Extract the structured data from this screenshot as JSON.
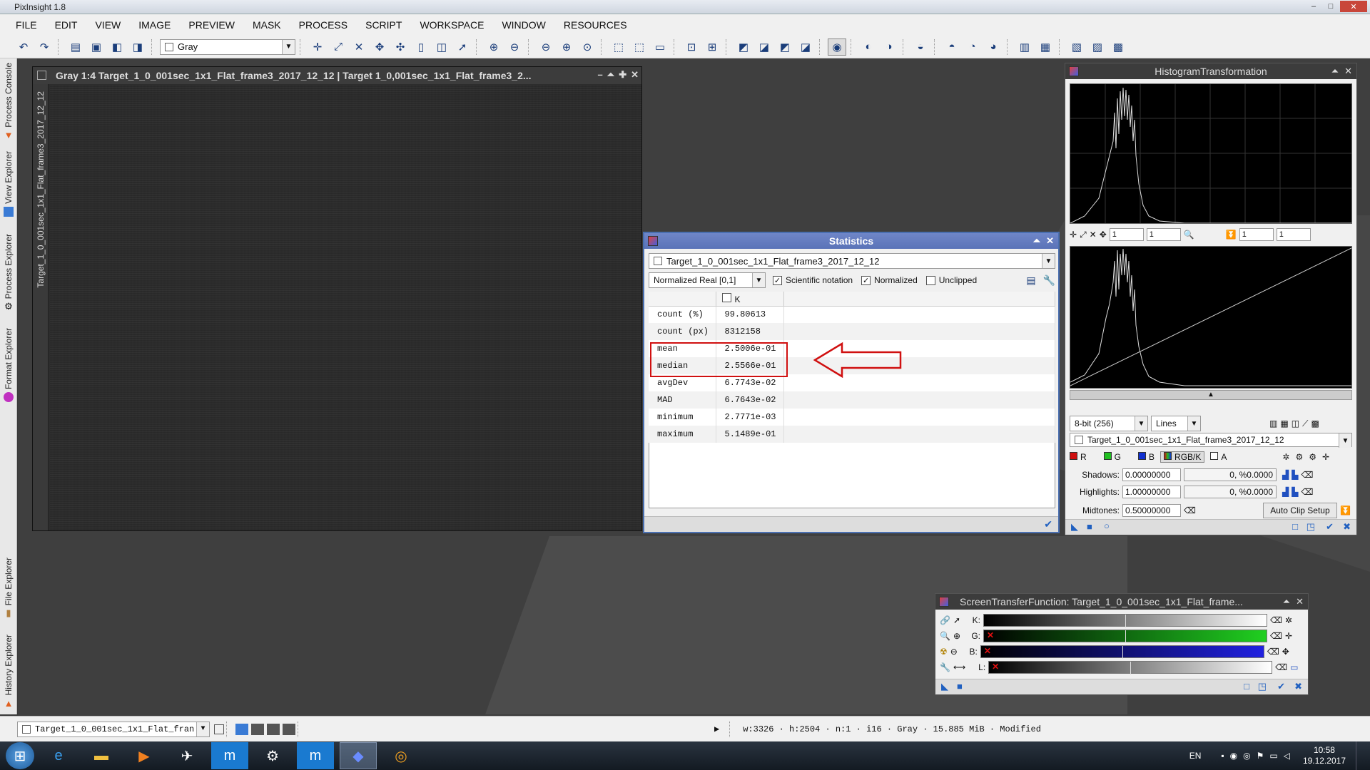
{
  "app": {
    "title": "PixInsight 1.8",
    "win_buttons": [
      "–",
      "□",
      "✕"
    ]
  },
  "menu": [
    "FILE",
    "EDIT",
    "VIEW",
    "IMAGE",
    "PREVIEW",
    "MASK",
    "PROCESS",
    "SCRIPT",
    "WORKSPACE",
    "WINDOW",
    "RESOURCES"
  ],
  "toolbar": {
    "channel_combo": "Gray"
  },
  "left_dock": {
    "tabs": [
      "Process Console",
      "View Explorer",
      "Process Explorer",
      "Format Explorer",
      "File Explorer",
      "History Explorer"
    ]
  },
  "image_window": {
    "title": "Gray 1:4 Target_1_0_001sec_1x1_Flat_frame3_2017_12_12 | Target 1_0,001sec_1x1_Flat_frame3_2...",
    "side_label": "Target_1_0_001sec_1x1_Flat_frame3_2017_12_12"
  },
  "statistics": {
    "title": "Statistics",
    "view": "Target_1_0_001sec_1x1_Flat_frame3_2017_12_12",
    "range": "Normalized Real [0,1]",
    "options": [
      {
        "label": "Scientific notation",
        "checked": true
      },
      {
        "label": "Normalized",
        "checked": true
      },
      {
        "label": "Unclipped",
        "checked": false
      }
    ],
    "channel_header": "K",
    "rows": [
      {
        "name": "count (%)",
        "value": "99.80613"
      },
      {
        "name": "count (px)",
        "value": "8312158"
      },
      {
        "name": "mean",
        "value": "2.5006e-01"
      },
      {
        "name": "median",
        "value": "2.5566e-01"
      },
      {
        "name": "avgDev",
        "value": "6.7743e-02"
      },
      {
        "name": "MAD",
        "value": "6.7643e-02"
      },
      {
        "name": "minimum",
        "value": "2.7771e-03"
      },
      {
        "name": "maximum",
        "value": "5.1489e-01"
      }
    ],
    "annotation_color": "#d01010"
  },
  "histogram": {
    "title": "HistogramTransformation",
    "zoom_values": [
      "1",
      "1",
      "1",
      "1"
    ],
    "bit_combo": "8-bit (256)",
    "graph_combo": "Lines",
    "view": "Target_1_0_001sec_1x1_Flat_frame3_2017_12_12",
    "channels": [
      {
        "label": "R",
        "color": "#d01010"
      },
      {
        "label": "G",
        "color": "#20c020"
      },
      {
        "label": "B",
        "color": "#1030d0"
      },
      {
        "label": "RGB/K",
        "color": "#444444"
      },
      {
        "label": "A",
        "color": "#ffffff"
      }
    ],
    "shadows": {
      "label": "Shadows:",
      "value": "0.00000000",
      "clip": "0, %0.0000"
    },
    "highlights": {
      "label": "Highlights:",
      "value": "1.00000000",
      "clip": "0, %0.0000"
    },
    "midtones": {
      "label": "Midtones:",
      "value": "0.50000000"
    },
    "auto_clip": "Auto Clip Setup"
  },
  "stf": {
    "title": "ScreenTransferFunction: Target_1_0_001sec_1x1_Flat_frame...",
    "channels": [
      {
        "label": "K:",
        "gradient": "linear-gradient(90deg,#000,#fff)"
      },
      {
        "label": "G:",
        "gradient": "linear-gradient(90deg,#000,#20d020)"
      },
      {
        "label": "B:",
        "gradient": "linear-gradient(90deg,#000,#2020e0)"
      },
      {
        "label": "L:",
        "gradient": "linear-gradient(90deg,#000,#fff)"
      }
    ]
  },
  "statusbar": {
    "view_combo": "Target_1_0_001sec_1x1_Flat_fran",
    "info": "w:3326 · h:2504 · n:1 · i16 · Gray · 15.885 MiB · Modified"
  },
  "taskbar": {
    "lang": "EN",
    "time": "10:58",
    "date": "19.12.2017"
  }
}
